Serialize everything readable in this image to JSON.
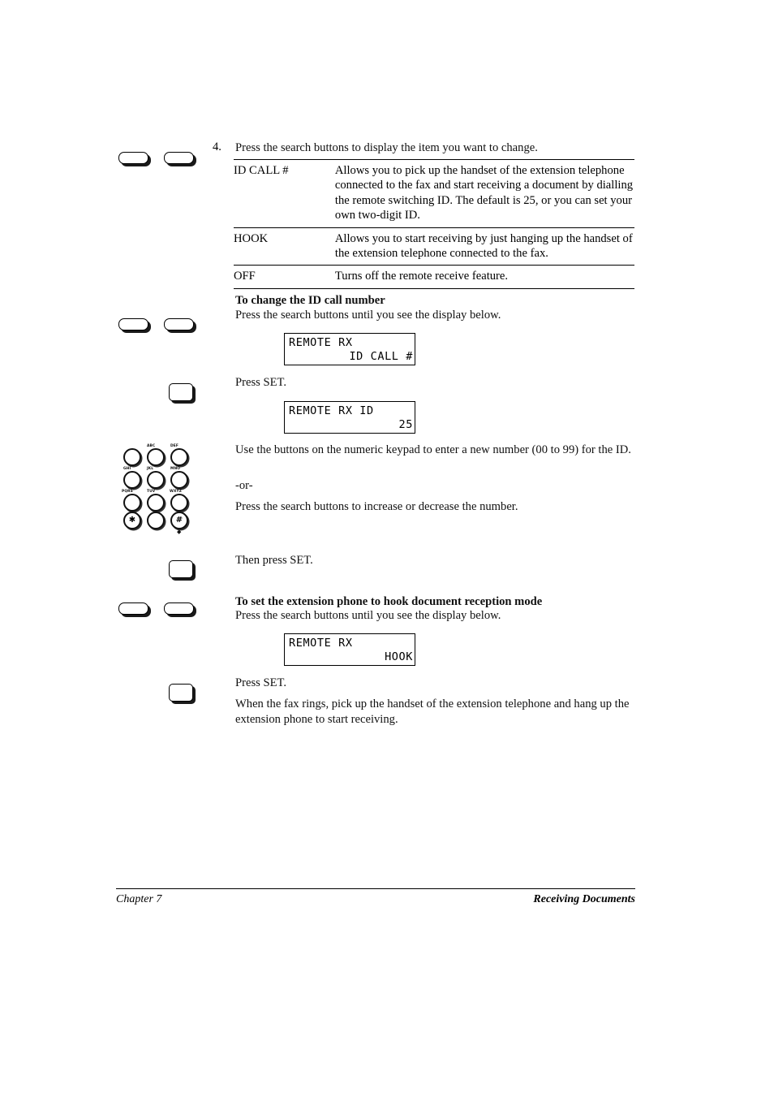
{
  "page": {
    "step_number": "4.",
    "step_instruction": "Press the search buttons to display the item you want to change."
  },
  "options_table": {
    "rows": [
      {
        "term": "ID CALL #",
        "description": "Allows you to pick up the handset of the extension telephone connected to the fax and start receiving a document by dialling the remote switching ID. The default is 25, or you can set your own two-digit ID."
      },
      {
        "term": "HOOK",
        "description": "Allows you to start receiving by just hanging up the handset of the extension telephone connected to the fax."
      },
      {
        "term": "OFF",
        "description": "Turns off the remote receive feature."
      }
    ]
  },
  "section_id_call": {
    "heading": "To change the ID call number",
    "intro": "Press the search buttons until you see the display below.",
    "display_1": {
      "line1": "REMOTE RX",
      "line2": "ID CALL #"
    },
    "press_set_1": "Press SET.",
    "display_2": {
      "line1": "REMOTE RX ID",
      "line2": "25"
    },
    "keypad_instruction": "Use the buttons on the numeric keypad to enter a new number (00 to 99) for the ID.",
    "or_text": "-or-",
    "search_instruction": "Press the search buttons to increase or decrease the number.",
    "then_press_set": "Then press SET."
  },
  "section_hook": {
    "heading": "To set the extension phone to hook document reception mode",
    "intro": "Press the search buttons until you see the display below.",
    "display_3": {
      "line1": "REMOTE RX",
      "line2": "HOOK"
    },
    "press_set_2": "Press SET.",
    "closing_text": "When the fax rings, pick up the handset of the extension telephone and hang up the extension phone to start receiving."
  },
  "keypad": {
    "keys": [
      {
        "glyph": "",
        "label": ""
      },
      {
        "glyph": "",
        "label": "ABC"
      },
      {
        "glyph": "",
        "label": "DEF"
      },
      {
        "glyph": "",
        "label": "GHI"
      },
      {
        "glyph": "",
        "label": "JKL"
      },
      {
        "glyph": "",
        "label": "MNO"
      },
      {
        "glyph": "",
        "label": "PQRS"
      },
      {
        "glyph": "",
        "label": "TUV"
      },
      {
        "glyph": "",
        "label": "WXYZ"
      },
      {
        "glyph": "✱",
        "label": ""
      },
      {
        "glyph": "",
        "label": ""
      },
      {
        "glyph": "#",
        "label": ""
      }
    ],
    "hash_marker": "◆"
  },
  "footer": {
    "left": "Chapter 7",
    "right": "Receiving Documents"
  },
  "colors": {
    "text": "#111111",
    "rule": "#000000",
    "page_background": "#ffffff"
  }
}
